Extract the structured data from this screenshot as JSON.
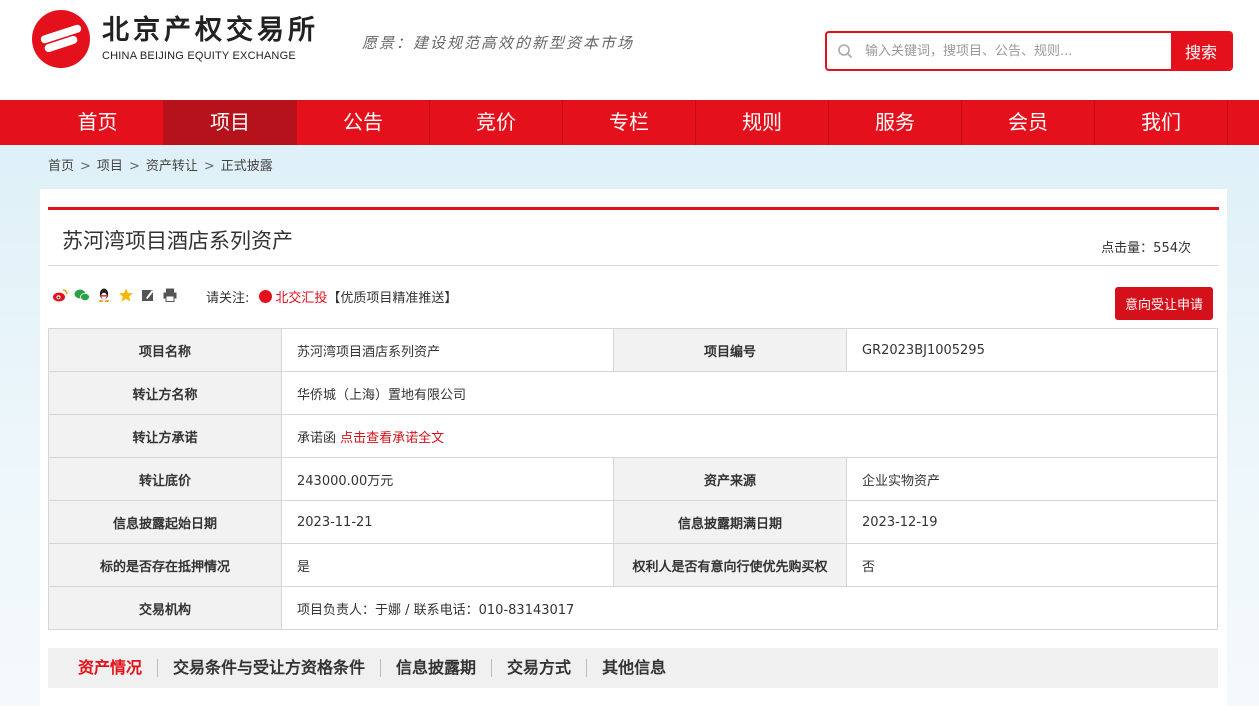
{
  "header": {
    "logo_cn": "北京产权交易所",
    "logo_en": "CHINA BEIJING EQUITY EXCHANGE",
    "slogan": "愿景：建设规范高效的新型资本市场",
    "search_placeholder": "输入关键词，搜项目、公告、规则...",
    "search_button": "搜索",
    "brand_color": "#e4101b"
  },
  "nav": {
    "items": [
      "首页",
      "项目",
      "公告",
      "竞价",
      "专栏",
      "规则",
      "服务",
      "会员",
      "我们"
    ],
    "active": "项目"
  },
  "breadcrumb": [
    "首页",
    "项目",
    "资产转让",
    "正式披露"
  ],
  "project": {
    "title": "苏河湾项目酒店系列资产",
    "clicks": "点击量：554次",
    "notice_label": "请关注:",
    "notice_link": "北交汇投",
    "notice_suffix": "【优质项目精准推送】",
    "apply_button": "意向受让申请"
  },
  "table": {
    "name_label": "项目名称",
    "name_value": "苏河湾项目酒店系列资产",
    "code_label": "项目编号",
    "code_value": "GR2023BJ1005295",
    "seller_label": "转让方名称",
    "seller_value": "华侨城（上海）置地有限公司",
    "promise_label": "转让方承诺",
    "promise_value": "承诺函",
    "promise_link": "点击查看承诺全文",
    "price_label": "转让底价",
    "price_value": "243000.00万元",
    "source_label": "资产来源",
    "source_value": "企业实物资产",
    "start_label": "信息披露起始日期",
    "start_value": "2023-11-21",
    "end_label": "信息披露期满日期",
    "end_value": "2023-12-19",
    "pledge_label": "标的是否存在抵押情况",
    "pledge_value": "是",
    "priority_label": "权利人是否有意向行使优先购买权",
    "priority_value": "否",
    "agency_label": "交易机构",
    "agency_value": "项目负责人：于娜 / 联系电话：010-83143017"
  },
  "tabs": [
    "资产情况",
    "交易条件与受让方资格条件",
    "信息披露期",
    "交易方式",
    "其他信息"
  ],
  "share_icons": [
    "weibo-icon",
    "wechat-icon",
    "qq-icon",
    "star-icon",
    "edit-icon",
    "print-icon"
  ]
}
